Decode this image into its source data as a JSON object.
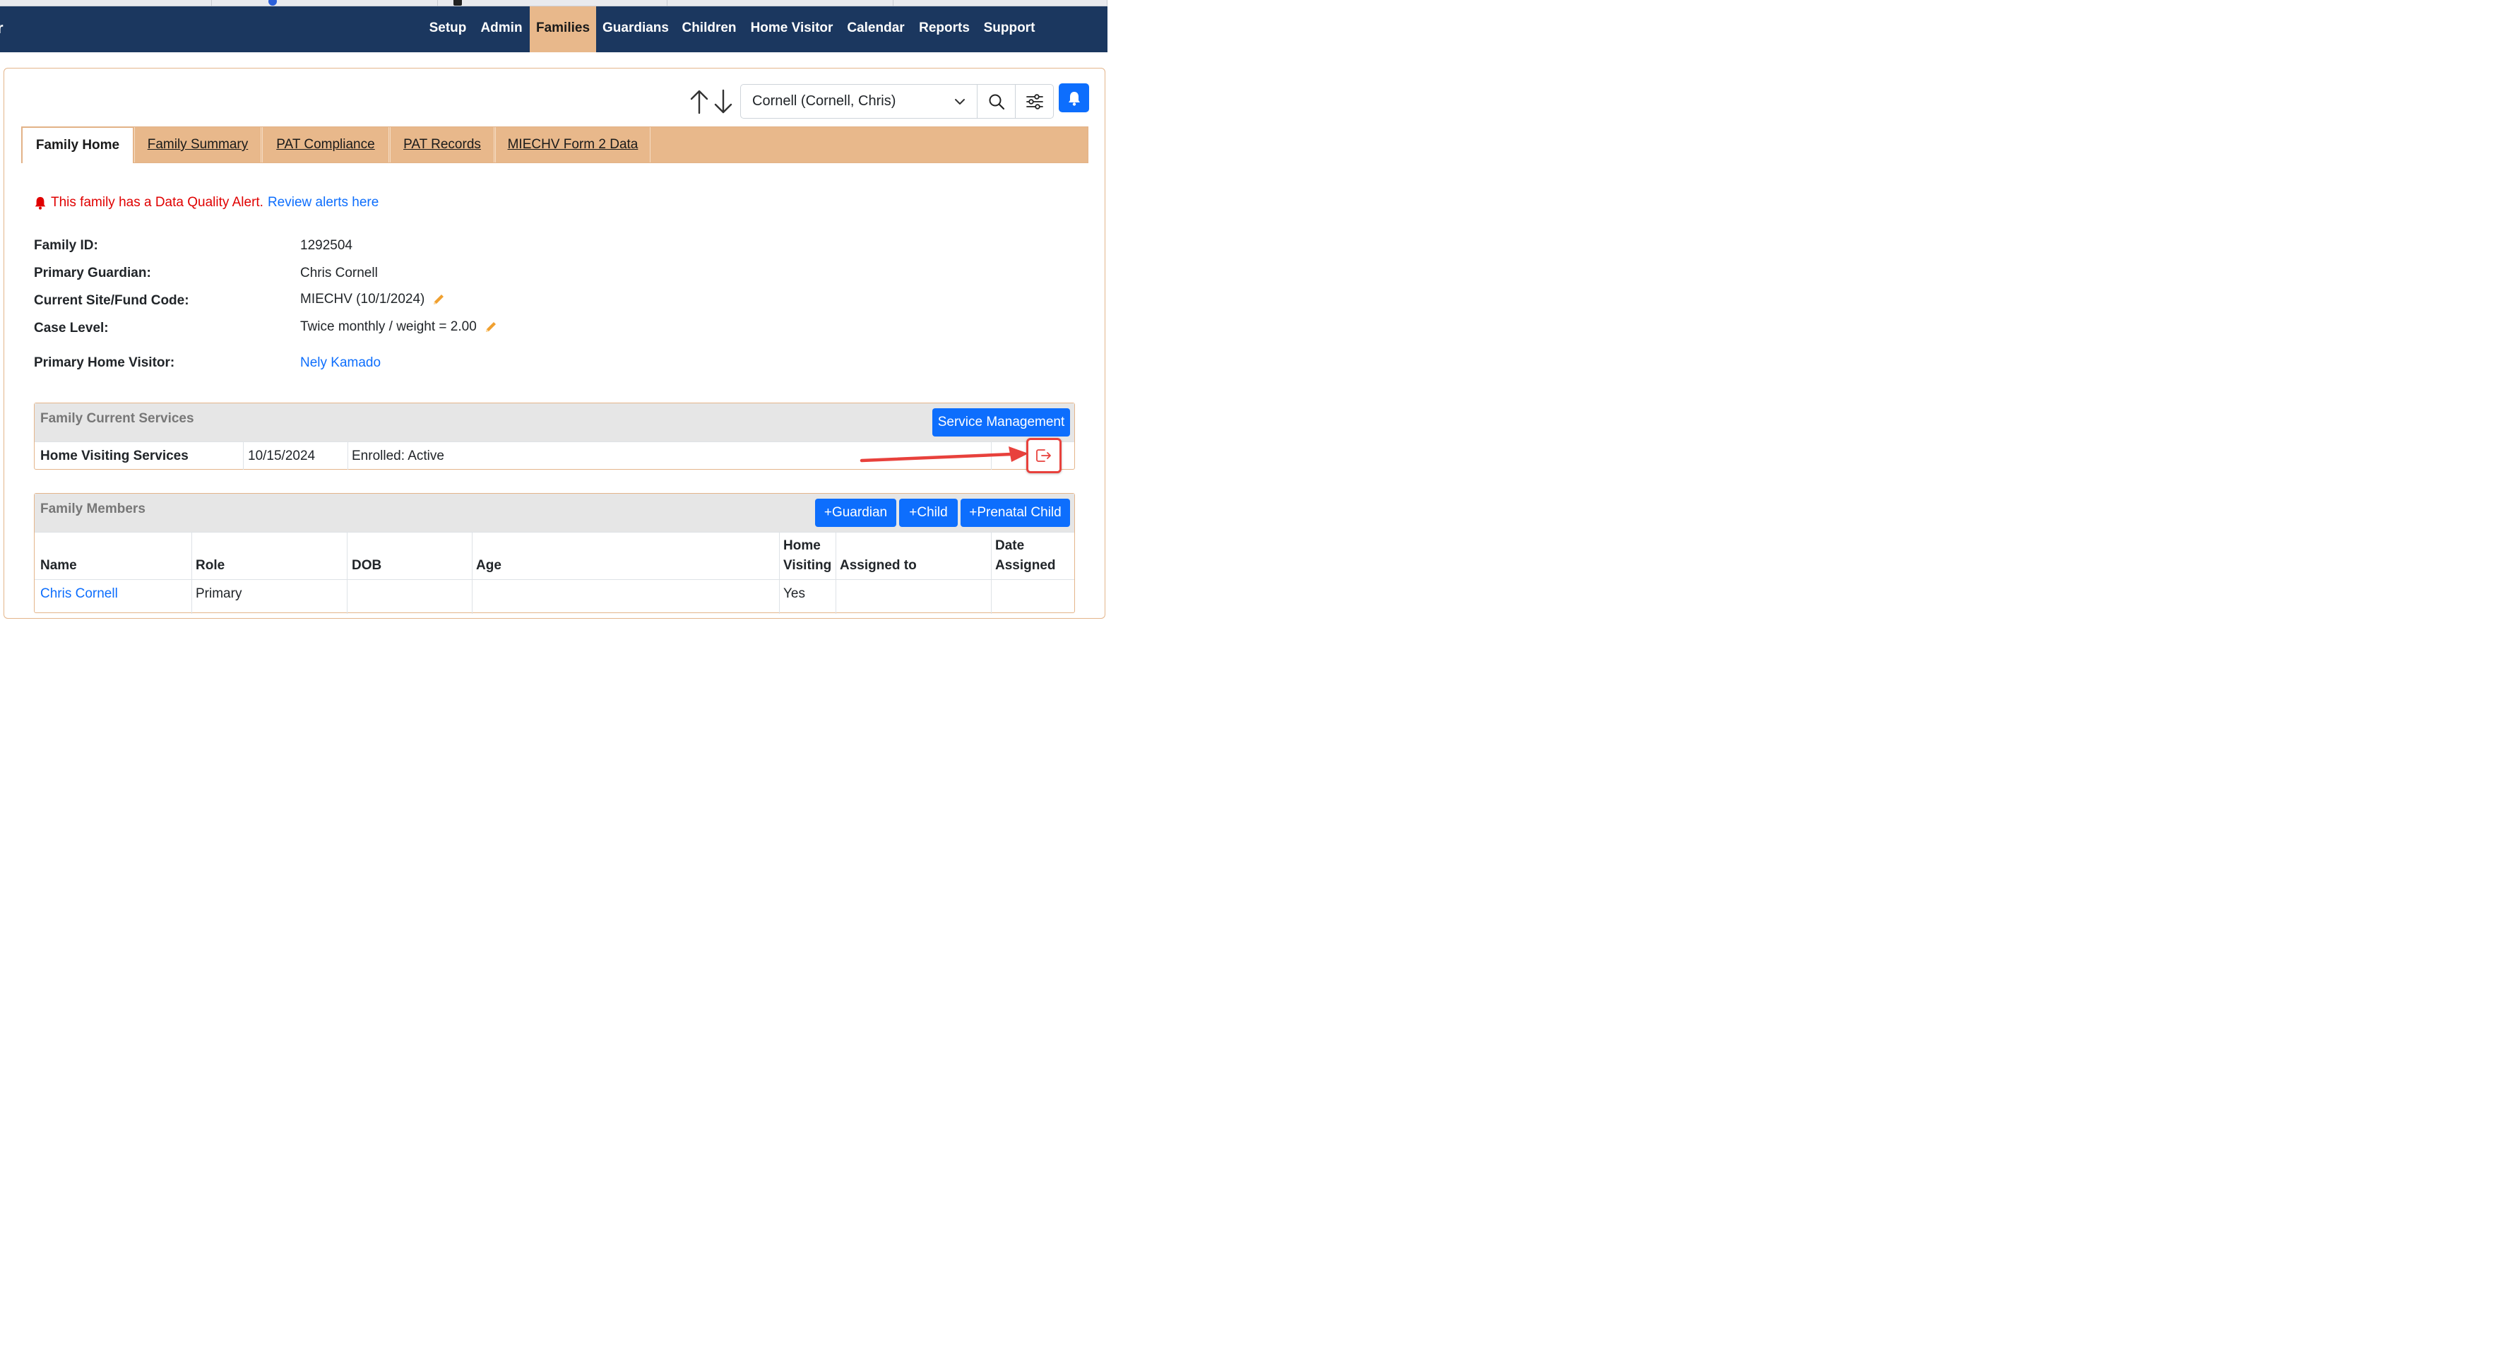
{
  "nav": {
    "brand_fragment": "r",
    "items": [
      {
        "label": "Setup",
        "active": false
      },
      {
        "label": "Admin",
        "active": false
      },
      {
        "label": "Families",
        "active": true
      },
      {
        "label": "Guardians",
        "active": false
      },
      {
        "label": "Children",
        "active": false
      },
      {
        "label": "Home Visitor",
        "active": false
      },
      {
        "label": "Calendar",
        "active": false
      },
      {
        "label": "Reports",
        "active": false
      },
      {
        "label": "Support",
        "active": false
      }
    ]
  },
  "toolbar": {
    "selected_family": "Cornell (Cornell, Chris)",
    "icons": [
      "arrow-up-icon",
      "arrow-down-icon",
      "search-icon",
      "filter-sliders-icon",
      "bell-icon"
    ]
  },
  "tabs": [
    {
      "label": "Family Home",
      "active": true
    },
    {
      "label": "Family Summary",
      "active": false
    },
    {
      "label": "PAT Compliance",
      "active": false
    },
    {
      "label": "PAT Records",
      "active": false
    },
    {
      "label": "MIECHV Form 2 Data",
      "active": false
    }
  ],
  "alert": {
    "text": "This family has a Data Quality Alert.",
    "link": "Review alerts here"
  },
  "family_info": [
    {
      "label": "Family ID:",
      "value": "1292504"
    },
    {
      "label": "Primary Guardian:",
      "value": "Chris Cornell"
    },
    {
      "label": "Current Site/Fund Code:",
      "value": "MIECHV (10/1/2024)"
    },
    {
      "label": "Case Level:",
      "value": "Twice monthly / weight = 2.00"
    },
    {
      "label": "Primary Home Visitor:",
      "value": "Nely Kamado"
    }
  ],
  "services": {
    "title": "Family Current Services",
    "button": "Service Management",
    "rows": [
      {
        "service": "Home Visiting Services",
        "date": "10/15/2024",
        "status": "Enrolled: Active"
      }
    ]
  },
  "members": {
    "title": "Family Members",
    "buttons": [
      "+Guardian",
      "+Child",
      "+Prenatal Child"
    ],
    "columns": [
      "Name",
      "Role",
      "DOB",
      "Age",
      "Home Visiting",
      "Assigned to",
      "Date Assigned"
    ],
    "rows": [
      {
        "name": "Chris Cornell",
        "role": "Primary",
        "dob": "",
        "age": "",
        "home_visiting": "Yes",
        "assigned_to": "",
        "date_assigned": ""
      }
    ]
  },
  "colors": {
    "nav_bg": "#1b375f",
    "accent_tan": "#e8b88b",
    "primary_blue": "#0d6efd",
    "alert_red": "#e00000",
    "annotation_red": "#e8413c"
  }
}
